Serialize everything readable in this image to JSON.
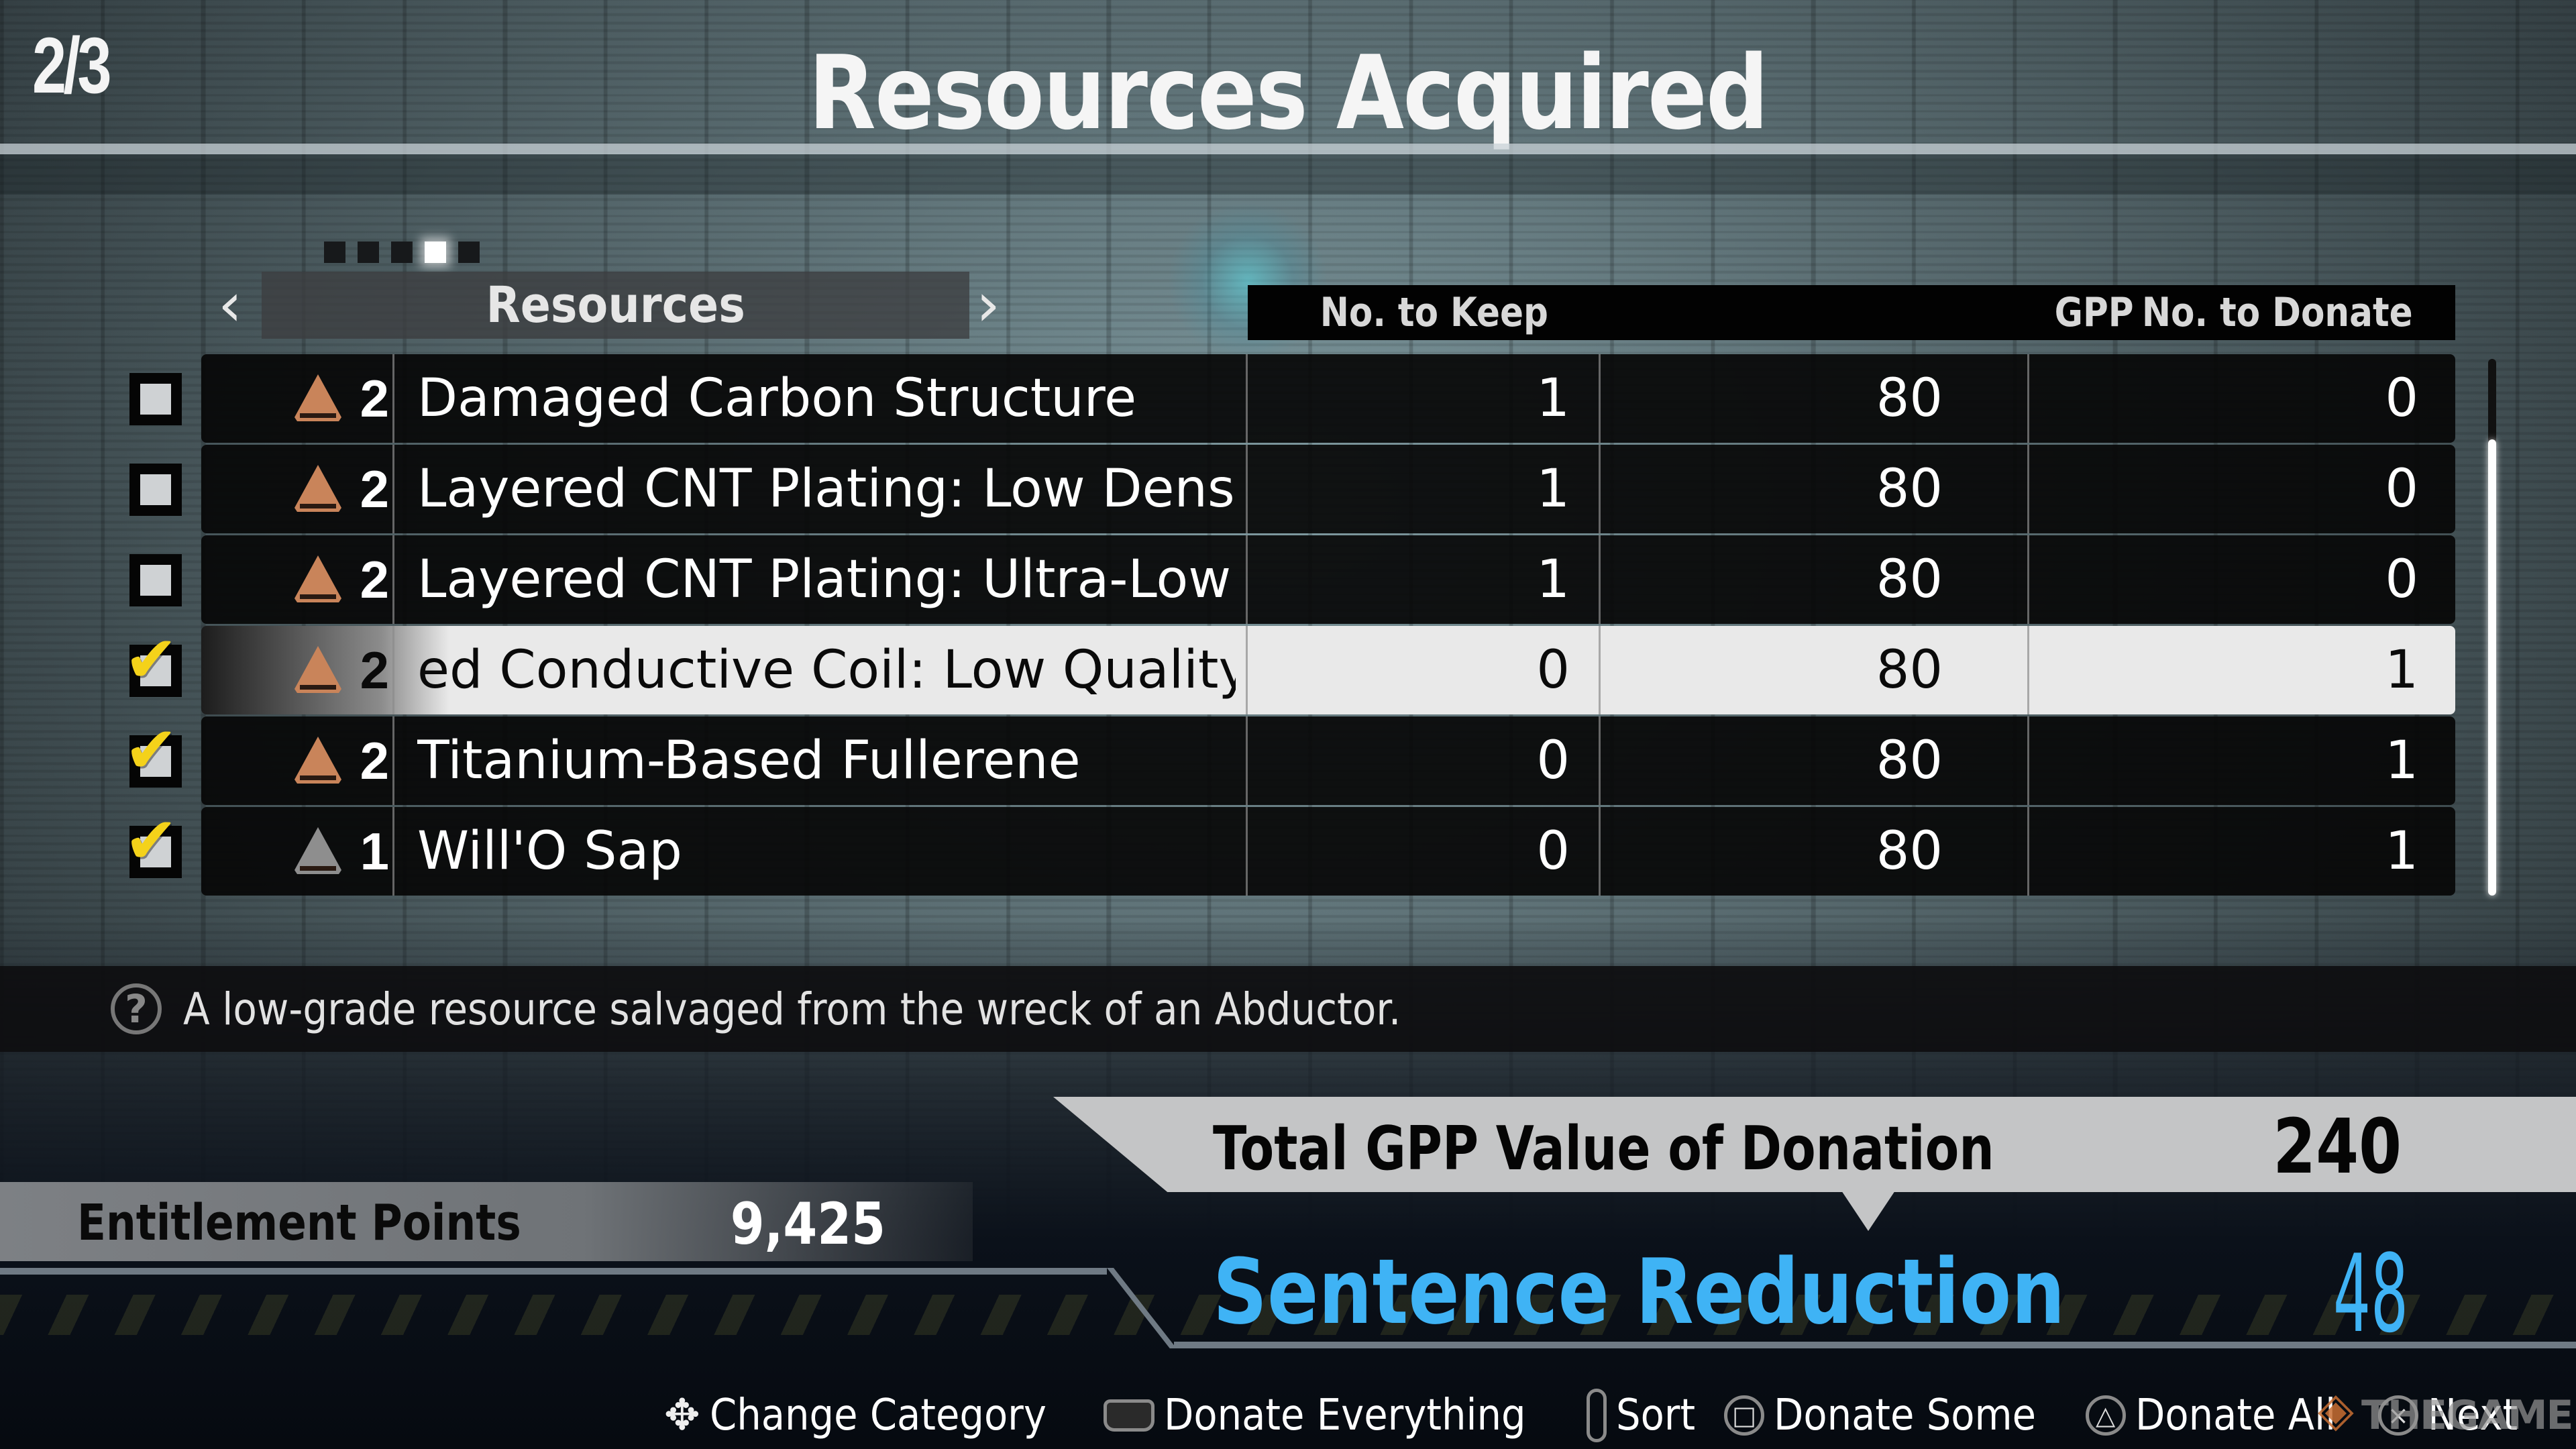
{
  "page_counter": "2/3",
  "title": "Resources Acquired",
  "category_tabs": {
    "dots_total": 5,
    "active_dot_index": 3,
    "current": "Resources",
    "prev_icon": "chevron-left-icon",
    "next_icon": "chevron-right-icon"
  },
  "table": {
    "columns": {
      "keep": "No. to Keep",
      "gpp": "GPP",
      "donate": "No. to Donate"
    },
    "rows": [
      {
        "checked": false,
        "rarity_color": "#c9845a",
        "rarity": "2",
        "name": "Damaged Carbon Structure",
        "keep": "1",
        "gpp": "80",
        "donate": "0",
        "selected": false
      },
      {
        "checked": false,
        "rarity_color": "#c9845a",
        "rarity": "2",
        "name": "Layered CNT Plating: Low Densi",
        "keep": "1",
        "gpp": "80",
        "donate": "0",
        "selected": false
      },
      {
        "checked": false,
        "rarity_color": "#c9845a",
        "rarity": "2",
        "name": "Layered CNT Plating: Ultra-Low",
        "keep": "1",
        "gpp": "80",
        "donate": "0",
        "selected": false
      },
      {
        "checked": true,
        "rarity_color": "#c9845a",
        "rarity": "2",
        "name": "ed Conductive Coil: Low Quality",
        "keep": "0",
        "gpp": "80",
        "donate": "1",
        "selected": true
      },
      {
        "checked": true,
        "rarity_color": "#c9845a",
        "rarity": "2",
        "name": "Titanium-Based Fullerene",
        "keep": "0",
        "gpp": "80",
        "donate": "1",
        "selected": false
      },
      {
        "checked": true,
        "rarity_color": "#8e8e8e",
        "rarity": "1",
        "name": "Will'O Sap",
        "keep": "0",
        "gpp": "80",
        "donate": "1",
        "selected": false
      }
    ],
    "scroll": {
      "thumb_start_fraction": 0.15,
      "thumb_end_fraction": 1.0
    }
  },
  "description": {
    "icon": "help-icon",
    "text": "A low-grade resource salvaged from the wreck of an Abductor."
  },
  "summary": {
    "total_label": "Total GPP Value of Donation",
    "total_value": "240",
    "entitlement_label": "Entitlement Points",
    "entitlement_value": "9,425",
    "sentence_label": "Sentence Reduction",
    "sentence_value": "48",
    "accent_color": "#3fb3f5"
  },
  "footer_hints": [
    {
      "icon": "dpad-icon",
      "glyph": "✥",
      "label": "Change Category"
    },
    {
      "icon": "touchpad-icon",
      "glyph": "",
      "label": "Donate Everything"
    },
    {
      "icon": "r3-stick-icon",
      "glyph": "≡",
      "label": "Sort"
    },
    {
      "icon": "square-button-icon",
      "glyph": "□",
      "label": "Donate Some"
    },
    {
      "icon": "triangle-button-icon",
      "glyph": "△",
      "label": "Donate All"
    },
    {
      "icon": "cross-button-icon",
      "glyph": "×",
      "label": "Next"
    }
  ],
  "watermark": "THEGAMER"
}
